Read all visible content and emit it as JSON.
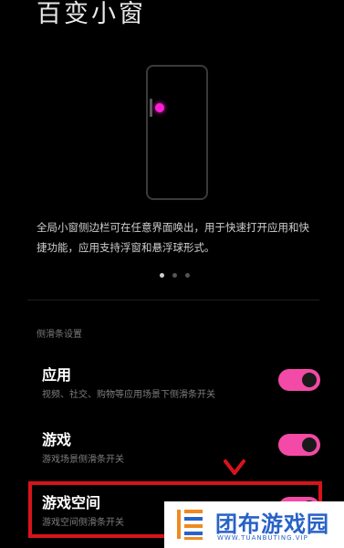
{
  "header": {
    "title": "百变小窗"
  },
  "intro": {
    "description": "全局小窗侧边栏可在任意界面唤出，用于快速打开应用和快捷功能，应用支持浮窗和悬浮球形式。",
    "pager": {
      "total": 3,
      "active": 1
    },
    "accent_color": "#ff1fd2"
  },
  "settings": {
    "section_label": "侧滑条设置",
    "items": [
      {
        "title": "应用",
        "desc": "视频、社交、购物等应用场景下侧滑条开关",
        "toggle_on": true
      },
      {
        "title": "游戏",
        "desc": "游戏场景侧滑条开关",
        "toggle_on": true
      },
      {
        "title": "游戏空间",
        "desc": "游戏空间侧滑条开关",
        "toggle_on": true
      }
    ],
    "toggle_color": "#f24aa6"
  },
  "annotation": {
    "highlight_color": "#d8131b"
  },
  "watermark": {
    "text": "团布游戏园",
    "sub": "WWW.TUANBUTING.VIP",
    "color": "#2862c8"
  }
}
